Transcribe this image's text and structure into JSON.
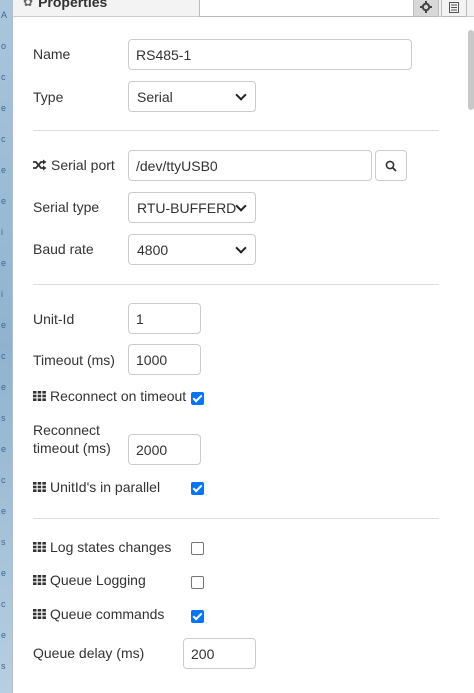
{
  "background_strip": {
    "glyphs": [
      "A",
      "o",
      "c",
      "e",
      "c",
      "e",
      "e",
      "i",
      "e",
      "i",
      "e",
      "c",
      "e",
      "s",
      "e",
      "c",
      "e",
      "s",
      "e",
      "c",
      "e",
      "s"
    ]
  },
  "header": {
    "title": "Properties",
    "title_icon": "gear-icon",
    "buttons": [
      {
        "icon": "gear-icon",
        "active": true
      },
      {
        "icon": "document-icon",
        "active": false
      }
    ]
  },
  "fields": {
    "name": {
      "label": "Name",
      "value": "RS485-1"
    },
    "type": {
      "label": "Type",
      "value": "Serial"
    },
    "serial_port": {
      "label": "Serial port",
      "icon": "shuffle-icon",
      "value": "/dev/ttyUSB0"
    },
    "serial_type": {
      "label": "Serial type",
      "value": "RTU-BUFFERD"
    },
    "baud_rate": {
      "label": "Baud rate",
      "value": "4800"
    },
    "unit_id": {
      "label": "Unit-Id",
      "value": "1"
    },
    "timeout": {
      "label": "Timeout (ms)",
      "value": "1000"
    },
    "reconnect_on_timeout": {
      "label": "Reconnect on timeout",
      "icon": "grid-icon",
      "checked": true
    },
    "reconnect_timeout": {
      "label_line1": "Reconnect",
      "label_line2": "timeout (ms)",
      "value": "2000"
    },
    "unitids_parallel": {
      "label": "UnitId's in parallel",
      "icon": "grid-icon",
      "checked": true
    },
    "log_states_changes": {
      "label": "Log states changes",
      "icon": "grid-icon",
      "checked": false
    },
    "queue_logging": {
      "label": "Queue Logging",
      "icon": "grid-icon",
      "checked": false
    },
    "queue_commands": {
      "label": "Queue commands",
      "icon": "grid-icon",
      "checked": true
    },
    "queue_delay": {
      "label": "Queue delay (ms)",
      "value": "200"
    }
  },
  "colors": {
    "checkbox_checked": "#0075ff",
    "border": "#cccccc",
    "divider": "#dddddd",
    "text": "#333333"
  }
}
